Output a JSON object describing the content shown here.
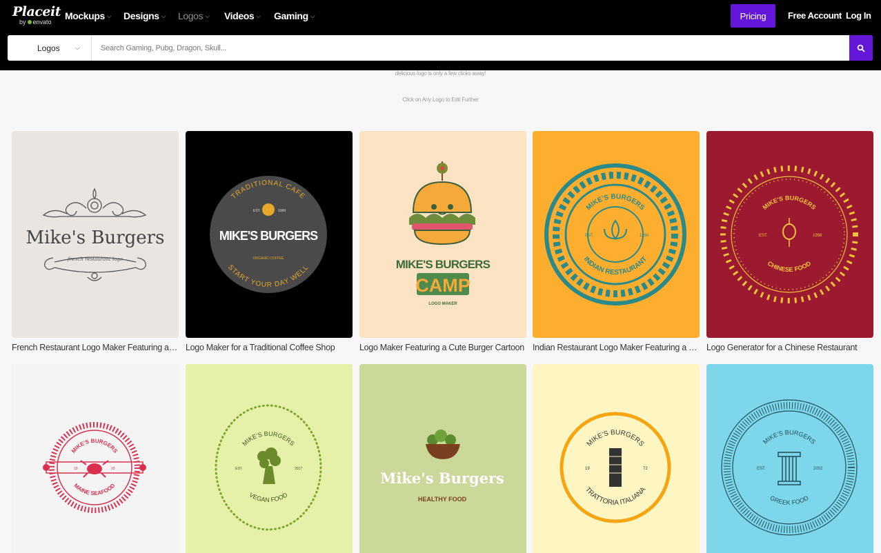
{
  "header": {
    "brand": "Placeit",
    "brand_sub": "envato",
    "nav": [
      {
        "label": "Mockups"
      },
      {
        "label": "Designs"
      },
      {
        "label": "Logos"
      },
      {
        "label": "Videos"
      },
      {
        "label": "Gaming"
      }
    ],
    "pricing": "Pricing",
    "free_account": "Free Account",
    "login": "Log In"
  },
  "search": {
    "category": "Logos",
    "placeholder": "Search Gaming, Pubg, Dragon, Skull..."
  },
  "intro": {
    "line1": "delicious logo is only a few clicks away!",
    "line2": "Click on Any Logo to Edit Further"
  },
  "cards": [
    {
      "title": "French Restaurant Logo Maker Featuring a C...",
      "logo_text": "Mike's Burgers",
      "logo_sub": "french restaurant logo"
    },
    {
      "title": "Logo Maker for a Traditional Coffee Shop",
      "logo_text": "MIKE'S BURGERS",
      "arc_top": "TRADITIONAL CAFE",
      "arc_bottom": "START YOUR DAY WELL",
      "est": "EST.",
      "year": "1989",
      "tag": "ORGANIC COFFEE"
    },
    {
      "title": "Logo Maker Featuring a Cute Burger Cartoon",
      "logo_text": "MIKE'S BURGERS",
      "logo_big": "CAMP",
      "logo_sub": "LOGO MAKER"
    },
    {
      "title": "Indian Restaurant Logo Maker Featuring a Fl...",
      "arc_top": "MIKE'S BURGERS",
      "arc_bottom": "INDIAN RESTAURANT",
      "est": "EST.",
      "year": "1986"
    },
    {
      "title": "Logo Generator for a Chinese Restaurant",
      "arc_top": "MIKE'S BURGERS",
      "arc_bottom": "CHINESE FOOD",
      "est": "EST.",
      "year": "1998"
    },
    {
      "title": "",
      "arc_top": "MIKE'S BURGERS",
      "arc_bottom": "MAINE SEAFOOD",
      "est": "19",
      "year": "93"
    },
    {
      "title": "",
      "arc_top": "MIKE'S BURGERS",
      "arc_bottom": "VEGAN FOOD",
      "est": "EST.",
      "year": "2017"
    },
    {
      "title": "",
      "logo_text": "Mike's Burgers",
      "logo_sub": "HEALTHY FOOD"
    },
    {
      "title": "",
      "arc_top": "MIKE'S BURGERS",
      "arc_bottom": "TRATTORIA ITALIANA",
      "est": "19",
      "year": "72"
    },
    {
      "title": "",
      "arc_top": "MIKE'S BURGERS",
      "arc_bottom": "GREEK FOOD",
      "est": "EST.",
      "year": "2002"
    }
  ],
  "colors": {
    "accent": "#6417d9",
    "card_bg": [
      "#e9e6e1",
      "#000000",
      "#fbe3c4",
      "#fdae2f",
      "#9b1a2f",
      "#f4f4f4",
      "#e5f0a8",
      "#cad89a",
      "#fdf6c3",
      "#7ed6ea"
    ]
  }
}
